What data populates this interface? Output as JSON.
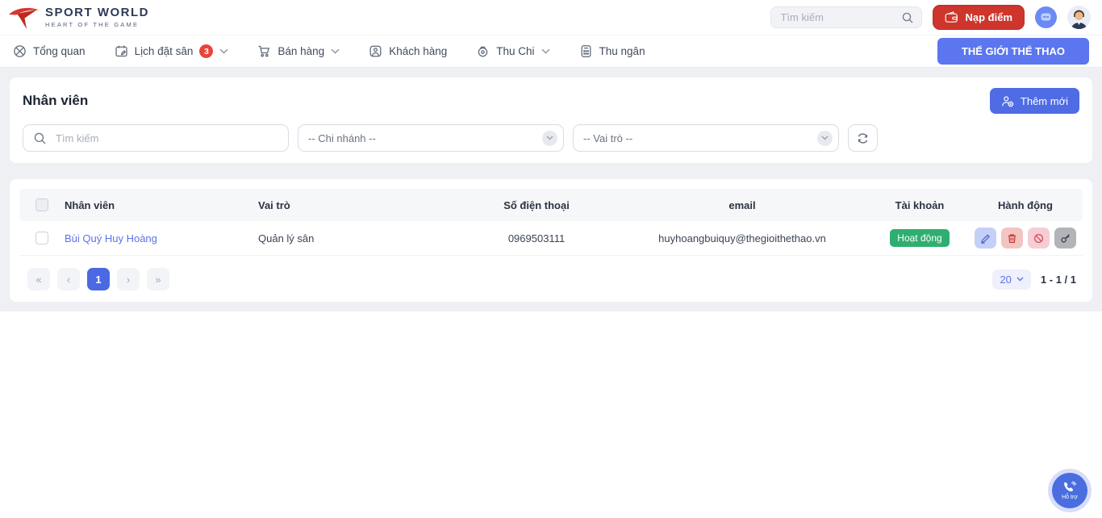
{
  "header": {
    "logo_title": "SPORT WORLD",
    "logo_subtitle": "HEART OF THE GAME",
    "search_placeholder": "Tìm kiếm",
    "topup_button": "Nạp điểm"
  },
  "nav": {
    "items": [
      {
        "label": "Tổng quan"
      },
      {
        "label": "Lịch đặt sân",
        "badge": "3"
      },
      {
        "label": "Bán hàng"
      },
      {
        "label": "Khách hàng"
      },
      {
        "label": "Thu Chi"
      },
      {
        "label": "Thu ngân"
      }
    ],
    "store_button": "THẾ GIỚI THỂ THAO"
  },
  "page": {
    "title": "Nhân viên",
    "add_button": "Thêm mới"
  },
  "filters": {
    "search_placeholder": "Tìm kiếm",
    "branch_select": "-- Chi nhánh --",
    "role_select": "-- Vai trò --"
  },
  "table": {
    "columns": {
      "employee": "Nhân viên",
      "role": "Vai trò",
      "phone": "Số điện thoại",
      "email": "email",
      "account": "Tài khoản",
      "actions": "Hành động"
    },
    "rows": [
      {
        "name": "Bùi Quý Huy Hoàng",
        "role": "Quản lý sân",
        "phone": "0969503111",
        "email": "huyhoangbuiquy@thegioithethao.vn",
        "status": "Hoạt động"
      }
    ]
  },
  "pagination": {
    "first": "«",
    "prev": "‹",
    "current": "1",
    "next": "›",
    "last": "»",
    "page_size": "20",
    "range_label": "1 - 1 / 1"
  },
  "support": {
    "label": "Hỗ trợ"
  },
  "colors": {
    "primary": "#4f6ce5",
    "nav_button": "#5b76ee",
    "danger": "#ce352c",
    "success": "#2fae70",
    "badge_red": "#e8453c"
  }
}
